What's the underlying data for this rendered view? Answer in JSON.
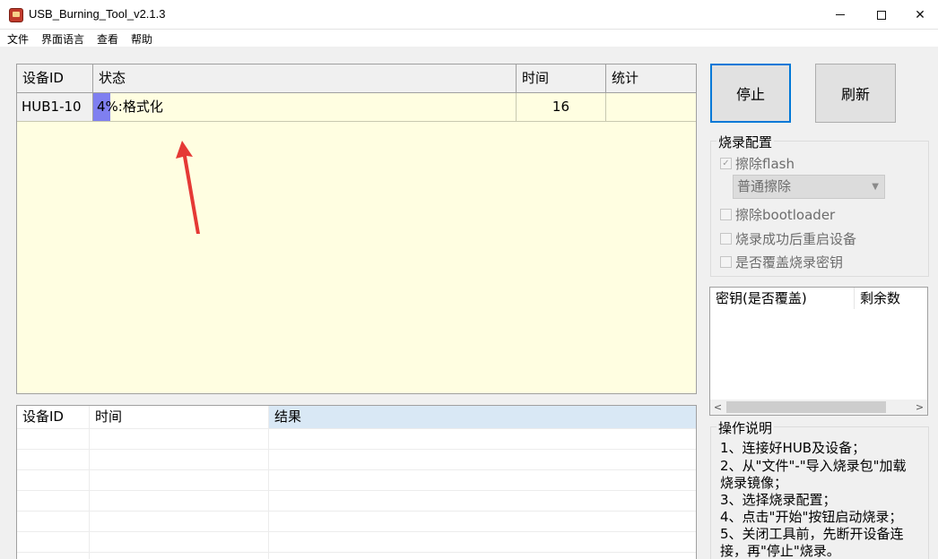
{
  "window": {
    "title": "USB_Burning_Tool_v2.1.3"
  },
  "menu": {
    "items": [
      "文件",
      "界面语言",
      "查看",
      "帮助"
    ]
  },
  "device_table": {
    "headers": [
      "设备ID",
      "状态",
      "时间",
      "统计"
    ],
    "rows": [
      {
        "id": "HUB1-10",
        "status": "4%:格式化",
        "progress": 0.04,
        "time": "16",
        "stats": ""
      }
    ]
  },
  "result_table": {
    "headers": [
      "设备ID",
      "时间",
      "结果"
    ]
  },
  "buttons": {
    "stop": "停止",
    "refresh": "刷新"
  },
  "burn_config": {
    "title": "烧录配置",
    "erase_flash": {
      "label": "擦除flash",
      "checked": true
    },
    "erase_mode": "普通擦除",
    "erase_bootloader": {
      "label": "擦除bootloader",
      "checked": false
    },
    "reboot_after": {
      "label": "烧录成功后重启设备",
      "checked": false
    },
    "overwrite_key": {
      "label": "是否覆盖烧录密钥",
      "checked": false
    }
  },
  "key_table": {
    "headers": [
      "密钥(是否覆盖)",
      "剩余数"
    ]
  },
  "instructions": {
    "title": "操作说明",
    "lines": [
      "1、连接好HUB及设备；",
      "2、从\"文件\"-\"导入烧录包\"加载",
      "烧录镜像；",
      "3、选择烧录配置；",
      "4、点击\"开始\"按钮启动烧录；",
      "5、关闭工具前，先断开设备连",
      "接，再\"停止\"烧录。"
    ]
  },
  "colors": {
    "grid_bg": "#fffee1",
    "progress": "#7f7ff0",
    "accent": "#0078d7",
    "arrow": "#e53935"
  }
}
